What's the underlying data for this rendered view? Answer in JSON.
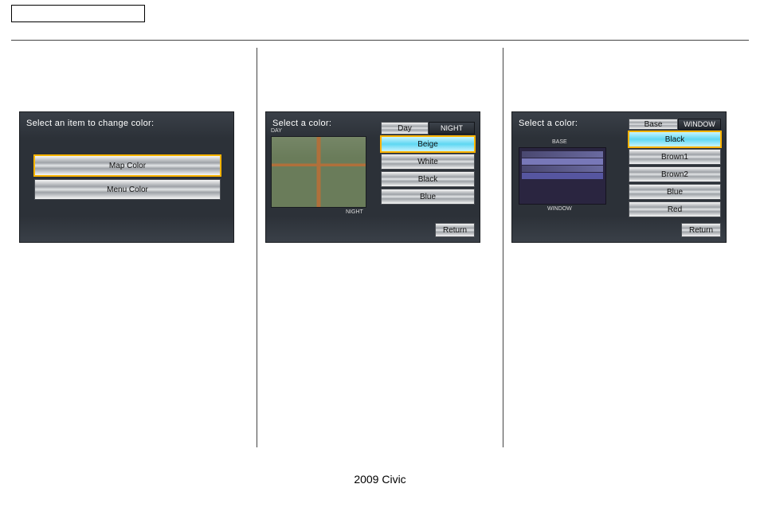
{
  "footer": "2009  Civic",
  "screen1": {
    "title": "Select an item to change color:",
    "options": [
      "Map Color",
      "Menu Color"
    ]
  },
  "screen2": {
    "title": "Select a color:",
    "tabs": [
      "Day",
      "NIGHT"
    ],
    "labels": {
      "day": "DAY",
      "night": "NIGHT"
    },
    "options": [
      "Beige",
      "White",
      "Black",
      "Blue"
    ],
    "return": "Return"
  },
  "screen3": {
    "title": "Select a color:",
    "tabs": [
      "Base",
      "WINDOW"
    ],
    "labels": {
      "base": "BASE",
      "window": "WINDOW"
    },
    "options": [
      "Black",
      "Brown1",
      "Brown2",
      "Blue",
      "Red"
    ],
    "return": "Return"
  }
}
